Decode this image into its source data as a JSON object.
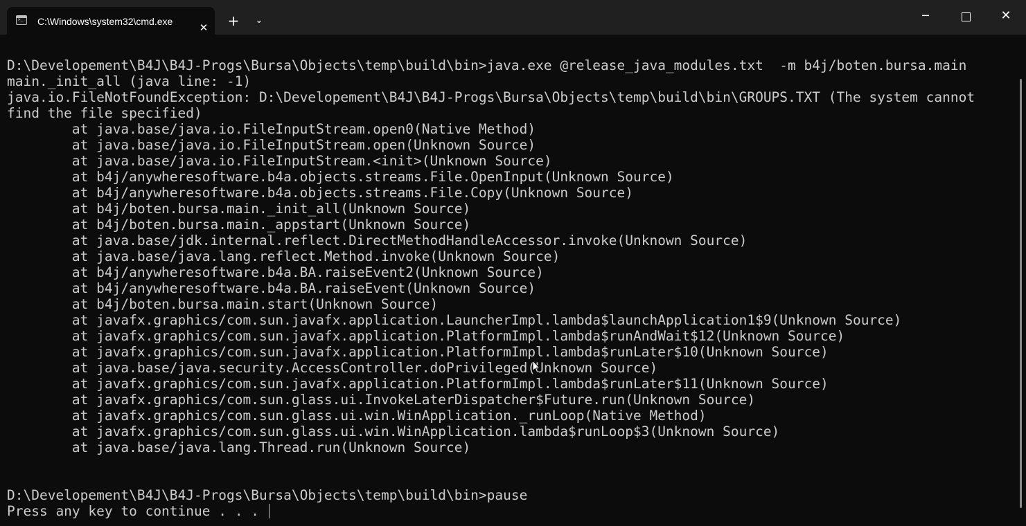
{
  "tab": {
    "title": "C:\\Windows\\system32\\cmd.exe",
    "close_glyph": "✕"
  },
  "titlebar": {
    "new_tab_glyph": "+",
    "dropdown_glyph": "⌄",
    "minimize_glyph": "─",
    "close_glyph": "✕"
  },
  "terminal": {
    "lines": [
      "D:\\Developement\\B4J\\B4J-Progs\\Bursa\\Objects\\temp\\build\\bin>java.exe @release_java_modules.txt  -m b4j/boten.bursa.main",
      "main._init_all (java line: -1)",
      "java.io.FileNotFoundException: D:\\Developement\\B4J\\B4J-Progs\\Bursa\\Objects\\temp\\build\\bin\\GROUPS.TXT (The system cannot",
      "find the file specified)",
      "        at java.base/java.io.FileInputStream.open0(Native Method)",
      "        at java.base/java.io.FileInputStream.open(Unknown Source)",
      "        at java.base/java.io.FileInputStream.<init>(Unknown Source)",
      "        at b4j/anywheresoftware.b4a.objects.streams.File.OpenInput(Unknown Source)",
      "        at b4j/anywheresoftware.b4a.objects.streams.File.Copy(Unknown Source)",
      "        at b4j/boten.bursa.main._init_all(Unknown Source)",
      "        at b4j/boten.bursa.main._appstart(Unknown Source)",
      "        at java.base/jdk.internal.reflect.DirectMethodHandleAccessor.invoke(Unknown Source)",
      "        at java.base/java.lang.reflect.Method.invoke(Unknown Source)",
      "        at b4j/anywheresoftware.b4a.BA.raiseEvent2(Unknown Source)",
      "        at b4j/anywheresoftware.b4a.BA.raiseEvent(Unknown Source)",
      "        at b4j/boten.bursa.main.start(Unknown Source)",
      "        at javafx.graphics/com.sun.javafx.application.LauncherImpl.lambda$launchApplication1$9(Unknown Source)",
      "        at javafx.graphics/com.sun.javafx.application.PlatformImpl.lambda$runAndWait$12(Unknown Source)",
      "        at javafx.graphics/com.sun.javafx.application.PlatformImpl.lambda$runLater$10(Unknown Source)",
      "        at java.base/java.security.AccessController.doPrivileged(Unknown Source)",
      "        at javafx.graphics/com.sun.javafx.application.PlatformImpl.lambda$runLater$11(Unknown Source)",
      "        at javafx.graphics/com.sun.glass.ui.InvokeLaterDispatcher$Future.run(Unknown Source)",
      "        at javafx.graphics/com.sun.glass.ui.win.WinApplication._runLoop(Native Method)",
      "        at javafx.graphics/com.sun.glass.ui.win.WinApplication.lambda$runLoop$3(Unknown Source)",
      "        at java.base/java.lang.Thread.run(Unknown Source)",
      "",
      "",
      "D:\\Developement\\B4J\\B4J-Progs\\Bursa\\Objects\\temp\\build\\bin>pause",
      "Press any key to continue . . . "
    ]
  },
  "colors": {
    "background": "#0c0c0c",
    "titlebar": "#202020",
    "text": "#cccccc",
    "accent_white": "#ffffff"
  },
  "icons": {
    "tab_icon": "command-prompt-icon",
    "cursor": "text-cursor",
    "pointer": "mouse-pointer-icon"
  }
}
